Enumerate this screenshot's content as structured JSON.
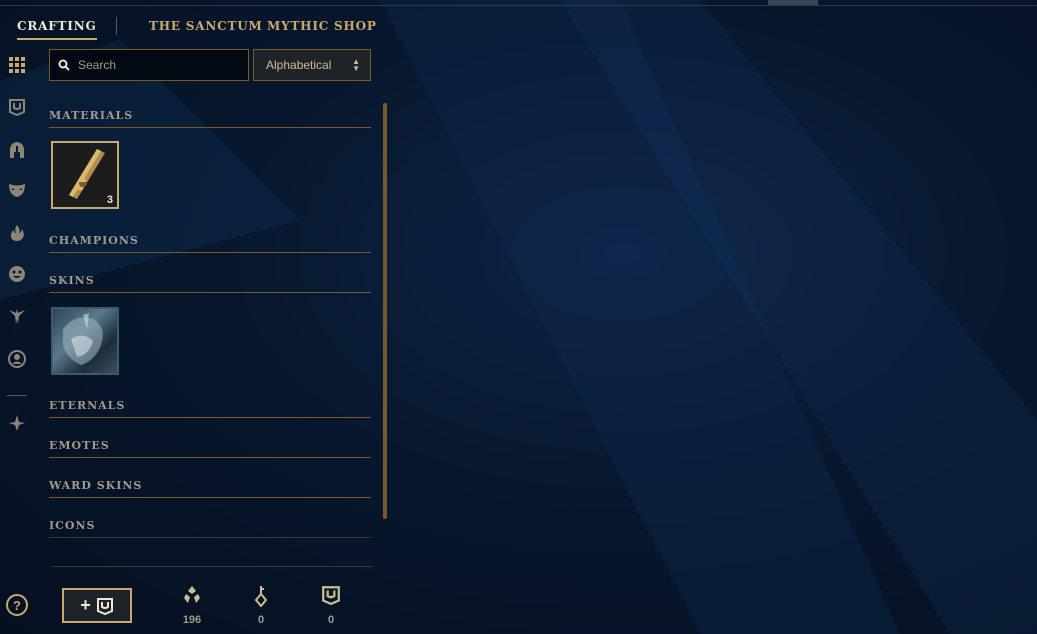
{
  "topnav": {
    "tabs": [
      {
        "label": "CRAFTING",
        "active": true
      },
      {
        "label": "THE SANCTUM"
      },
      {
        "label": "MYTHIC SHOP"
      }
    ]
  },
  "rail": {
    "icons": [
      "grid-icon",
      "chest-icon",
      "helmet-icon",
      "mask-icon",
      "flame-icon",
      "emote-face-icon",
      "ward-icon",
      "profile-icon",
      "ability-icon"
    ],
    "help_label": "?"
  },
  "search": {
    "placeholder": "Search"
  },
  "sort": {
    "selected": "Alphabetical"
  },
  "sections": {
    "materials": "MATERIALS",
    "champions": "CHAMPIONS",
    "skins": "SKINS",
    "eternals": "ETERNALS",
    "emotes": "EMOTES",
    "ward_skins": "WARD SKINS",
    "icons": "ICONS"
  },
  "materials": {
    "key_fragment_count": "3"
  },
  "footer": {
    "add_label": "+",
    "currencies": [
      {
        "icon": "blue-essence-icon",
        "value": "196"
      },
      {
        "icon": "key-icon",
        "value": "0"
      },
      {
        "icon": "chest-icon",
        "value": "0"
      }
    ]
  },
  "colors": {
    "gold": "#c8aa6e",
    "dark_gold": "#785a28",
    "bg": "#08172e"
  }
}
